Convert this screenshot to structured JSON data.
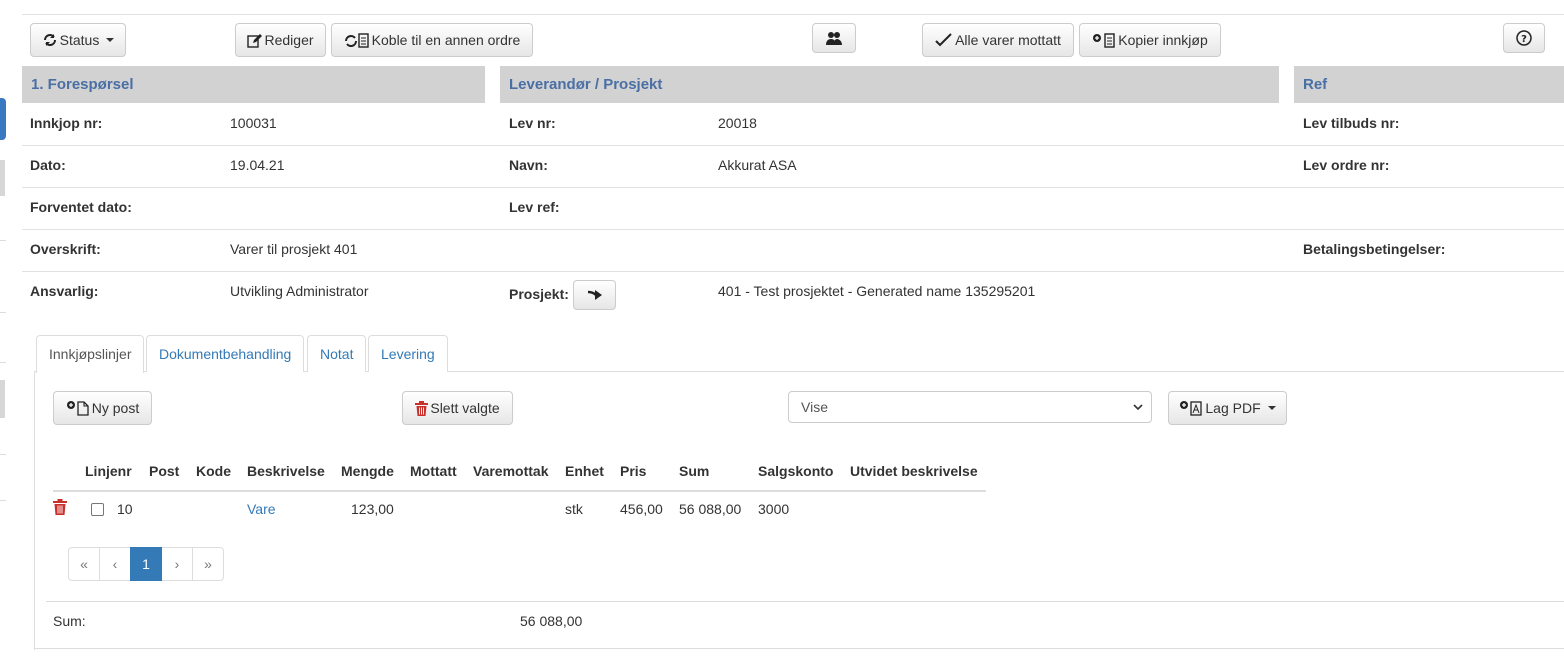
{
  "toolbar": {
    "status_label": "Status",
    "edit_label": "Rediger",
    "link_order_label": "Koble til en annen ordre",
    "all_received_label": "Alle varer mottatt",
    "copy_purchase_label": "Kopier innkjøp"
  },
  "sections": {
    "request": "1. Forespørsel",
    "supplier": "Leverandør / Prosjekt",
    "ref": "Ref"
  },
  "request": {
    "purchase_no_label": "Innkjop nr:",
    "purchase_no": "100031",
    "date_label": "Dato:",
    "date": "19.04.21",
    "expected_date_label": "Forventet dato:",
    "expected_date": "",
    "heading_label": "Overskrift:",
    "heading": "Varer til prosjekt 401",
    "responsible_label": "Ansvarlig:",
    "responsible": "Utvikling Administrator"
  },
  "supplier": {
    "no_label": "Lev nr:",
    "no": "20018",
    "name_label": "Navn:",
    "name": "Akkurat ASA",
    "ref_label": "Lev ref:",
    "ref": "",
    "project_label": "Prosjekt:",
    "project": "401 - Test prosjektet - Generated name 135295201"
  },
  "ref": {
    "offer_no_label": "Lev tilbuds nr:",
    "order_no_label": "Lev ordre nr:",
    "payment_terms_label": "Betalingsbetingelser:"
  },
  "tabs": [
    {
      "label": "Innkjøpslinjer",
      "active": true
    },
    {
      "label": "Dokumentbehandling",
      "active": false
    },
    {
      "label": "Notat",
      "active": false
    },
    {
      "label": "Levering",
      "active": false
    }
  ],
  "lines_toolbar": {
    "new_post_label": "Ny post",
    "delete_selected_label": "Slett valgte",
    "view_select_value": "Vise",
    "make_pdf_label": "Lag PDF"
  },
  "table": {
    "columns": [
      "Linjenr",
      "Post",
      "Kode",
      "Beskrivelse",
      "Mengde",
      "Mottatt",
      "Varemottak",
      "Enhet",
      "Pris",
      "Sum",
      "Salgskonto",
      "Utvidet beskrivelse"
    ],
    "rows": [
      {
        "linjenr": "10",
        "post": "",
        "kode": "",
        "beskrivelse": "Vare",
        "mengde": "123,00",
        "mottatt": "",
        "varemottak": "",
        "enhet": "stk",
        "pris": "456,00",
        "sum": "56 088,00",
        "salgskonto": "3000",
        "utvidet": ""
      }
    ]
  },
  "pagination": {
    "first": "«",
    "prev": "‹",
    "current": "1",
    "next": "›",
    "last": "»"
  },
  "total": {
    "label": "Sum:",
    "value": "56 088,00"
  },
  "icons": {
    "status": "refresh-icon",
    "edit": "edit-icon",
    "link": "link-order-icon",
    "users": "users-icon",
    "check": "check-icon",
    "copy": "copy-icon",
    "help": "help-icon",
    "arrow": "arrow-right-icon",
    "trash": "trash-icon"
  },
  "colors": {
    "header_bg": "#d2d2d2",
    "header_text": "#4a6fa5",
    "link": "#337ab7",
    "danger": "#c9302c",
    "active_page": "#337ab7"
  }
}
